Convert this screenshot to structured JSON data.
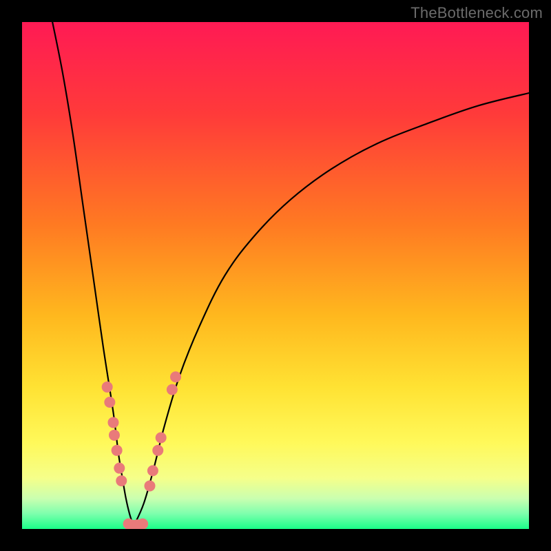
{
  "watermark": {
    "text": "TheBottleneck.com"
  },
  "chart_data": {
    "type": "line",
    "title": "",
    "xlabel": "",
    "ylabel": "",
    "xlim": [
      0,
      100
    ],
    "ylim": [
      0,
      100
    ],
    "background_gradient": {
      "stops": [
        {
          "offset": 0.0,
          "color": "#ff1a54"
        },
        {
          "offset": 0.18,
          "color": "#ff3a3a"
        },
        {
          "offset": 0.4,
          "color": "#ff7a22"
        },
        {
          "offset": 0.58,
          "color": "#ffb81e"
        },
        {
          "offset": 0.72,
          "color": "#ffe233"
        },
        {
          "offset": 0.83,
          "color": "#fff95a"
        },
        {
          "offset": 0.9,
          "color": "#f5ff8a"
        },
        {
          "offset": 0.94,
          "color": "#caffb0"
        },
        {
          "offset": 0.97,
          "color": "#7dffad"
        },
        {
          "offset": 1.0,
          "color": "#1aff88"
        }
      ]
    },
    "series": [
      {
        "name": "left-branch",
        "x": [
          6,
          8,
          10,
          12,
          14,
          16,
          18,
          19,
          19.8,
          20.5,
          21.2,
          22
        ],
        "y": [
          100,
          90,
          78,
          64,
          50,
          36,
          23,
          15,
          10,
          6,
          3,
          0.5
        ]
      },
      {
        "name": "right-branch",
        "x": [
          22,
          24,
          26,
          28,
          31,
          35,
          40,
          46,
          53,
          61,
          70,
          80,
          90,
          100
        ],
        "y": [
          0.5,
          5,
          12,
          20,
          30,
          40,
          50,
          58,
          65,
          71,
          76,
          80,
          83.5,
          86
        ]
      }
    ],
    "scatter": {
      "name": "highlighted-points",
      "color": "#e97a7a",
      "radius": 8,
      "points": [
        {
          "x": 16.8,
          "y": 28
        },
        {
          "x": 17.3,
          "y": 25
        },
        {
          "x": 18.0,
          "y": 21
        },
        {
          "x": 18.2,
          "y": 18.5
        },
        {
          "x": 18.7,
          "y": 15.5
        },
        {
          "x": 19.2,
          "y": 12
        },
        {
          "x": 19.6,
          "y": 9.5
        },
        {
          "x": 21.0,
          "y": 1.0
        },
        {
          "x": 22.0,
          "y": 0.7
        },
        {
          "x": 22.8,
          "y": 0.8
        },
        {
          "x": 23.8,
          "y": 1.0
        },
        {
          "x": 25.2,
          "y": 8.5
        },
        {
          "x": 25.8,
          "y": 11.5
        },
        {
          "x": 26.8,
          "y": 15.5
        },
        {
          "x": 27.4,
          "y": 18.0
        },
        {
          "x": 29.6,
          "y": 27.5
        },
        {
          "x": 30.3,
          "y": 30.0
        }
      ]
    }
  }
}
